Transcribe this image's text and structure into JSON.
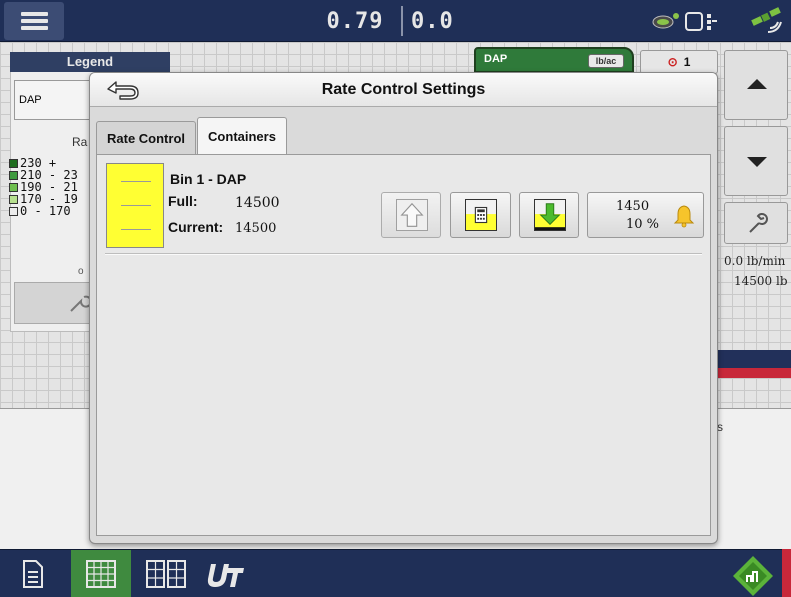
{
  "topbar": {
    "readout_primary": "0.79",
    "readout_secondary": "0.0"
  },
  "legend": {
    "title": "Legend",
    "product": "DAP",
    "rate_header": "Ra",
    "rows": [
      {
        "label": "230 +",
        "color": "#1f6d1f"
      },
      {
        "label": "210 - 23",
        "color": "#3f9a3f"
      },
      {
        "label": "190 - 21",
        "color": "#6fbf4f"
      },
      {
        "label": "170 - 19",
        "color": "#b7e08f"
      },
      {
        "label": "0 - 170",
        "color": "#ececec"
      }
    ],
    "dot": "o"
  },
  "product_header": {
    "name": "DAP",
    "unit": "lb/ac"
  },
  "counter": {
    "value": "1"
  },
  "side": {
    "flow_rate": "0.0 lb/min",
    "bin_total": "14500 lb"
  },
  "bottom_panel": {
    "trailing_text": "s"
  },
  "modal": {
    "title": "Rate Control Settings",
    "tabs": [
      {
        "label": "Rate Control",
        "active": false
      },
      {
        "label": "Containers",
        "active": true
      }
    ],
    "container": {
      "name": "Bin 1 - DAP",
      "full_label": "Full:",
      "full_value": "14500",
      "current_label": "Current:",
      "current_value": "14500",
      "alarm_value": "1450",
      "alarm_percent": "10 %",
      "fill_color": "#ffff33"
    }
  },
  "colors": {
    "bar_navy": "#1f2f57",
    "accent_green": "#3f8a3f",
    "alert_red": "#c8283a"
  }
}
